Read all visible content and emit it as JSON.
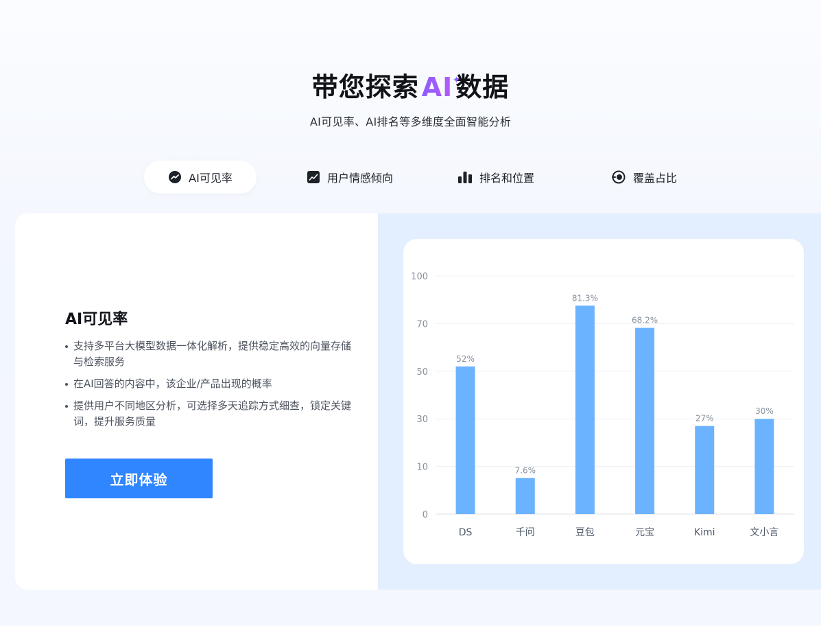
{
  "hero": {
    "title_before": "带您探索",
    "title_ai": "AI",
    "title_after": "数据",
    "subtitle": "AI可见率、AI排名等多维度全面智能分析"
  },
  "tabs": [
    {
      "label": "AI可见率",
      "icon": "trend-circle-icon",
      "active": true
    },
    {
      "label": "用户情感倾向",
      "icon": "line-chart-square-icon",
      "active": false
    },
    {
      "label": "排名和位置",
      "icon": "bar-chart-icon",
      "active": false
    },
    {
      "label": "覆盖占比",
      "icon": "target-ring-icon",
      "active": false
    }
  ],
  "feature": {
    "title": "AI可见率",
    "bullets": [
      "支持多平台大模型数据一体化解析，提供稳定高效的向量存储与检索服务",
      "在AI回答的内容中，该企业/产品出现的概率",
      "提供用户不同地区分析，可选择多天追踪方式细查，锁定关键词，提升服务质量"
    ],
    "cta_label": "立即体验"
  },
  "colors": {
    "accent": "#2f86ff",
    "bar": "#6cb3ff",
    "ai_gradient_start": "#8d5cff",
    "ai_gradient_end": "#b55cf5",
    "panel_right_bg": "#e3eefe"
  },
  "chart_data": {
    "type": "bar",
    "categories": [
      "DS",
      "千问",
      "豆包",
      "元宝",
      "Kimi",
      "文小言"
    ],
    "values": [
      52,
      7.6,
      81.3,
      68.2,
      27,
      30
    ],
    "data_labels": [
      "52%",
      "7.6%",
      "81.3%",
      "68.2%",
      "27%",
      "30%"
    ],
    "y_ticks": [
      0,
      10,
      30,
      50,
      70,
      100
    ],
    "grid": true,
    "title": "",
    "xlabel": "",
    "ylabel": ""
  }
}
